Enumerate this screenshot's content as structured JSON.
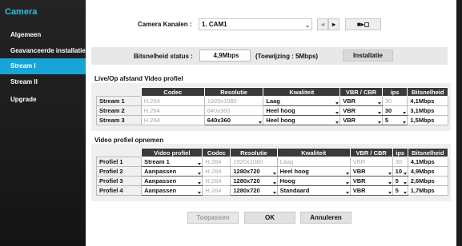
{
  "sidebar": {
    "title": "Camera",
    "items": [
      {
        "label": "Algemeen",
        "active": false
      },
      {
        "label": "Geavanceerde installatie",
        "active": false
      },
      {
        "label": "Stream I",
        "active": true
      },
      {
        "label": "Stream II",
        "active": false
      },
      {
        "label": "Upgrade",
        "active": false
      }
    ]
  },
  "camera_select": {
    "label": "Camera Kanalen :",
    "value": "1. CAM1",
    "prev_icon": "prev-icon",
    "next_icon": "next-icon",
    "copy_icon": "copy-icon"
  },
  "bitrate_status": {
    "label": "Bitsnelheid status :",
    "value": "4,9Mbps",
    "allocation": "(Toewijzing : 5Mbps)",
    "install_button": "Installatie"
  },
  "live_profile": {
    "title": "Live/Op afstand Video profiel",
    "headers": [
      "Codec",
      "Resolutie",
      "Kwaliteit",
      "VBR / CBR",
      "ips",
      "Bitsnelheid"
    ],
    "rows": [
      {
        "name": "Stream 1",
        "codec": "H.264",
        "resolution": "1920x1080",
        "quality": "Laag",
        "mode": "VBR",
        "ips": "30",
        "bitrate": "4,1Mbps"
      },
      {
        "name": "Stream 2",
        "codec": "H.264",
        "resolution": "640x360",
        "quality": "Heel hoog",
        "mode": "VBR",
        "ips": "30",
        "bitrate": "3,1Mbps"
      },
      {
        "name": "Stream 3",
        "codec": "H.264",
        "resolution": "640x360",
        "quality": "Heel hoog",
        "mode": "VBR",
        "ips": "5",
        "bitrate": "1,5Mbps"
      }
    ]
  },
  "record_profile": {
    "title": "Video profiel opnemen",
    "headers": [
      "Video profiel",
      "Codec",
      "Resolutie",
      "Kwaliteit",
      "VBR / CBR",
      "ips",
      "Bitsnelheid"
    ],
    "rows": [
      {
        "name": "Profiel 1",
        "profile": "Stream 1",
        "codec": "H.264",
        "resolution": "1920x1080",
        "quality": "Laag",
        "mode": "VBR",
        "ips": "30",
        "bitrate": "4,1Mbps"
      },
      {
        "name": "Profiel 2",
        "profile": "Aanpassen",
        "codec": "H.264",
        "resolution": "1280x720",
        "quality": "Heel hoog",
        "mode": "VBR",
        "ips": "10",
        "bitrate": "4,9Mbps"
      },
      {
        "name": "Profiel 3",
        "profile": "Aanpassen",
        "codec": "H.264",
        "resolution": "1280x720",
        "quality": "Hoog",
        "mode": "VBR",
        "ips": "5",
        "bitrate": "2,6Mbps"
      },
      {
        "name": "Profiel 4",
        "profile": "Aanpassen",
        "codec": "H.264",
        "resolution": "1280x720",
        "quality": "Standaard",
        "mode": "VBR",
        "ips": "5",
        "bitrate": "1,7Mbps"
      }
    ]
  },
  "footer": {
    "apply": "Toepassen",
    "ok": "OK",
    "cancel": "Annuleren"
  }
}
